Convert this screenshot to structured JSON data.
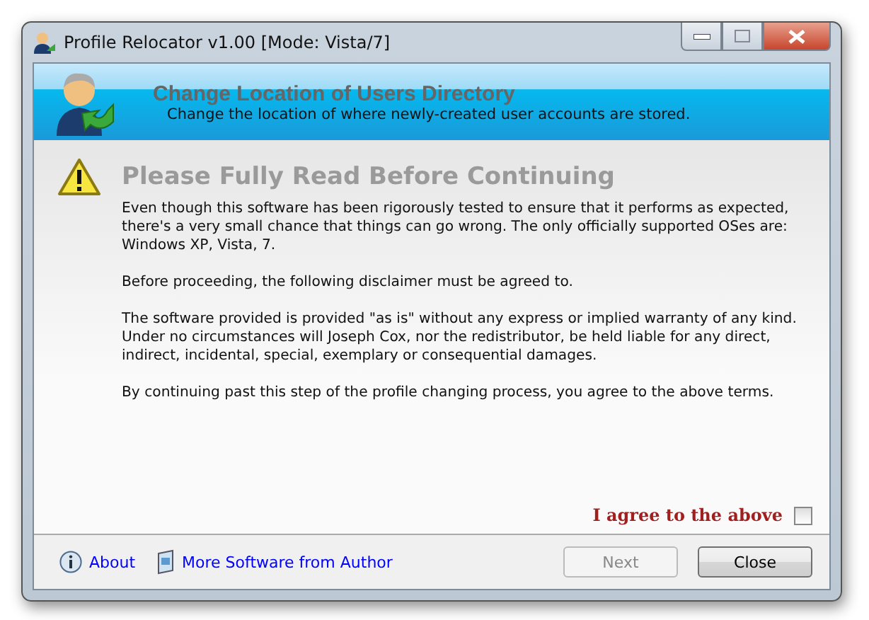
{
  "window": {
    "title": "Profile Relocator v1.00 [Mode: Vista/7]"
  },
  "banner": {
    "title": "Change Location of Users Directory",
    "subtitle": "Change the location of where newly-created user accounts are stored."
  },
  "notice": {
    "heading": "Please Fully Read Before Continuing",
    "paragraphs": [
      "Even though this software has been rigorously tested to ensure that it performs as expected, there's a very small chance that things can go wrong. The only officially supported OSes are: Windows XP, Vista, 7.",
      "Before proceeding, the following disclaimer must be agreed to.",
      "The software provided is provided \"as is\" without any express or implied warranty of any kind. Under no circumstances will Joseph Cox, nor the redistributor, be held liable for any direct, indirect, incidental, special, exemplary or consequential damages.",
      "By continuing past this step of the profile changing process, you agree to the above terms."
    ]
  },
  "agree": {
    "label": "I agree to the above",
    "checked": false
  },
  "links": [
    {
      "kind": "info",
      "label": "About"
    },
    {
      "kind": "software",
      "label": "More Software from Author"
    }
  ],
  "buttons": [
    {
      "label": "Next",
      "disabled": true
    },
    {
      "label": "Close",
      "disabled": false
    }
  ]
}
